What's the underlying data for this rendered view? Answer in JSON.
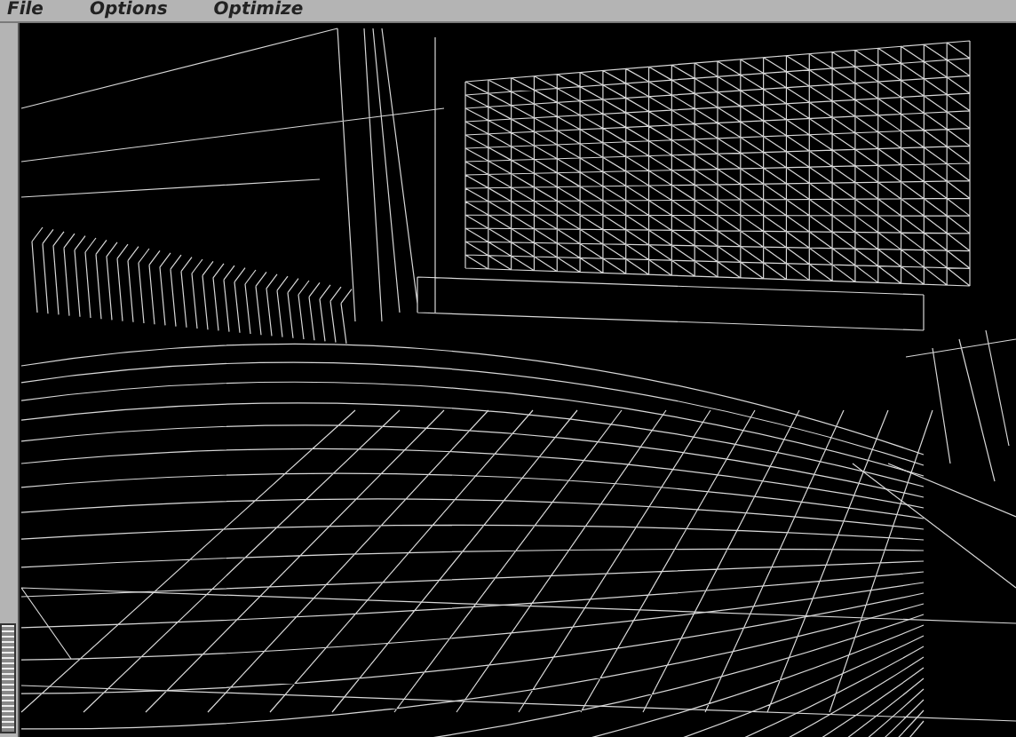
{
  "menu": [
    {
      "label": "File"
    },
    {
      "label": "Options"
    },
    {
      "label": "Optimize"
    }
  ]
}
